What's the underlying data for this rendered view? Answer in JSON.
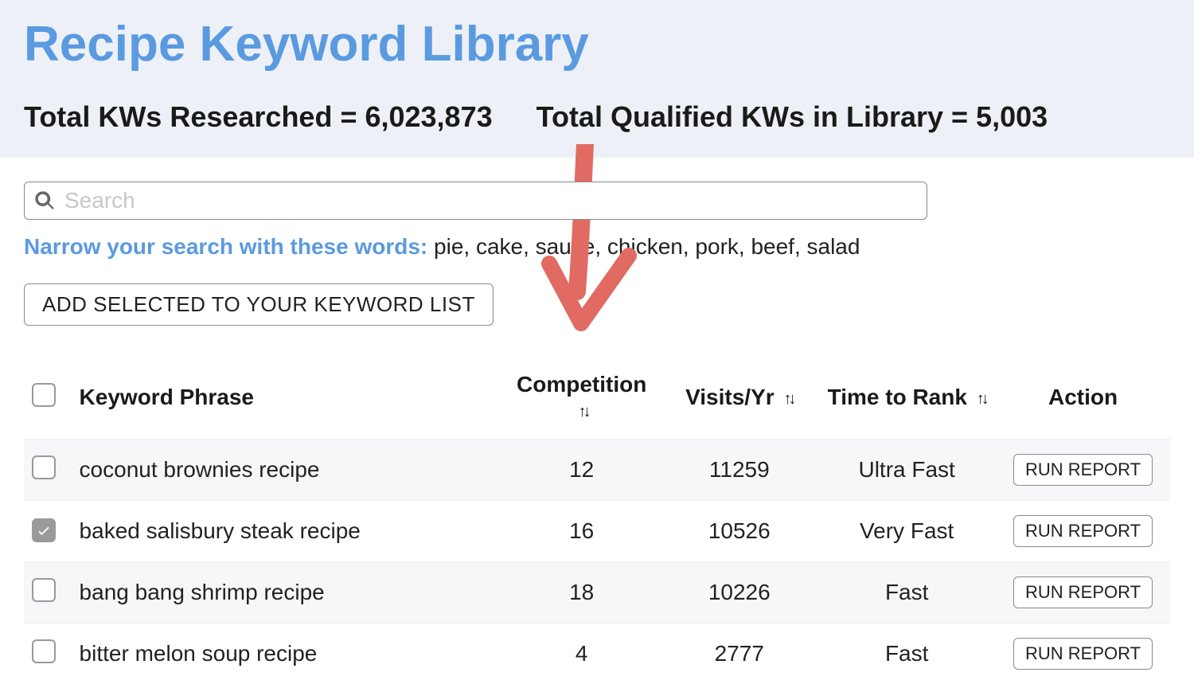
{
  "header": {
    "title": "Recipe Keyword Library",
    "stat1_label": "Total KWs Researched = ",
    "stat1_value": "6,023,873",
    "stat2_label": "Total Qualified KWs in Library = ",
    "stat2_value": "5,003"
  },
  "search": {
    "placeholder": "Search"
  },
  "narrow": {
    "prompt": "Narrow your search with these words: ",
    "words": "pie, cake, sauce, chicken, pork, beef, salad"
  },
  "buttons": {
    "add_selected": "ADD SELECTED TO YOUR KEYWORD LIST",
    "run_report": "RUN REPORT"
  },
  "table": {
    "headers": {
      "phrase": "Keyword Phrase",
      "competition": "Competition",
      "visits": "Visits/Yr",
      "rank": "Time to Rank",
      "action": "Action"
    },
    "rows": [
      {
        "checked": false,
        "phrase": "coconut brownies recipe",
        "competition": "12",
        "visits": "11259",
        "rank": "Ultra Fast"
      },
      {
        "checked": true,
        "phrase": "baked salisbury steak recipe",
        "competition": "16",
        "visits": "10526",
        "rank": "Very Fast"
      },
      {
        "checked": false,
        "phrase": "bang bang shrimp recipe",
        "competition": "18",
        "visits": "10226",
        "rank": "Fast"
      },
      {
        "checked": false,
        "phrase": "bitter melon soup recipe",
        "competition": "4",
        "visits": "2777",
        "rank": "Fast"
      }
    ]
  }
}
